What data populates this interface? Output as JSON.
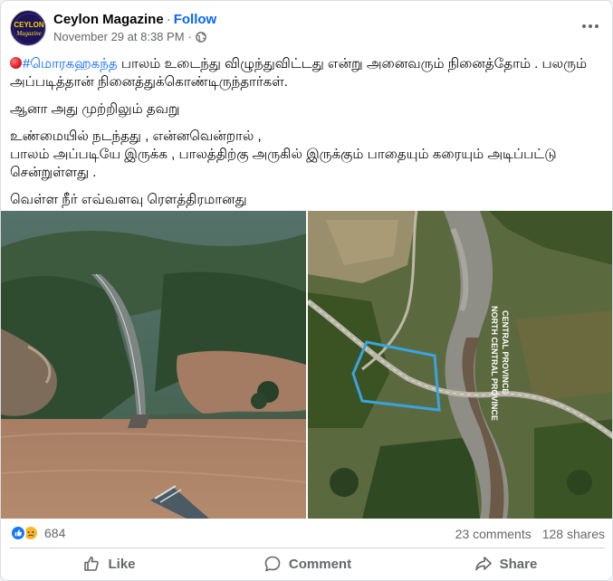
{
  "post": {
    "page_name": "Ceylon Magazine",
    "separator": "·",
    "follow_label": "Follow",
    "timestamp": "November 29 at 8:38 PM",
    "meta_separator": "·",
    "privacy_icon": "globe-icon",
    "avatar_text_top": "CEYLON",
    "avatar_text_bottom": "Magazine"
  },
  "content": {
    "hashtag": "#மொரகஹகந்த",
    "line1_rest": " பாலம் உடைந்து விழுந்துவிட்டது என்று அனைவரும் நினைத்தோம் . பலரும் அப்படித்தான் நினைத்துக்கொண்டிருந்தார்கள்.",
    "line2": "ஆனா அது முற்றிலும் தவறு",
    "line3": "உண்மையில் நடந்தது , என்னவென்றால் ,",
    "line4": "பாலம் அப்படியே இருக்க , பாலத்திற்கு அருகில் இருக்கும் பாதையும் கரையும் அடிப்பட்டு சென்றுள்ளது .",
    "line5": "வெள்ள நீர் எவ்வளவு ரௌத்திரமானது"
  },
  "images": {
    "left_label": "aerial-flood-photo",
    "right_label": "satellite-bridge-photo",
    "map_text_1": "CENTRAL PROVINCE",
    "map_text_2": "NORTH CENTRAL PROVINCE"
  },
  "stats": {
    "reaction_icons": [
      "like-icon",
      "sad-icon"
    ],
    "reaction_count": "684",
    "comments": "23 comments",
    "shares": "128 shares"
  },
  "actions": {
    "like_label": "Like",
    "comment_label": "Comment",
    "share_label": "Share"
  },
  "colors": {
    "accent": "#0866ff",
    "secondary_text": "#65676b",
    "like_blue": "#1877f2",
    "sad_yellow": "#f7b928"
  }
}
